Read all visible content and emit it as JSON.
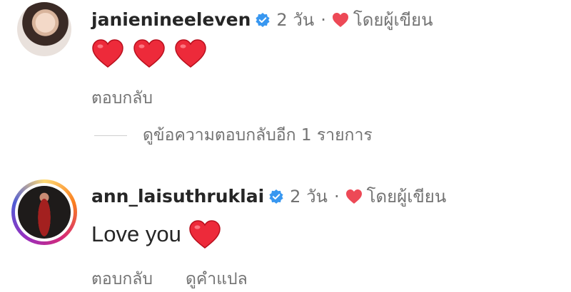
{
  "comments": [
    {
      "username": "janienineeleven",
      "time": "2 วัน",
      "separator": "·",
      "liked_by_author": "โดยผู้เขียน",
      "text": "",
      "reply_label": "ตอบกลับ",
      "view_replies": "ดูข้อความตอบกลับอีก 1 รายการ"
    },
    {
      "username": "ann_laisuthruklai",
      "time": "2 วัน",
      "separator": "·",
      "liked_by_author": "โดยผู้เขียน",
      "text": "Love you",
      "reply_label": "ตอบกลับ",
      "see_translation": "ดูคำแปล"
    }
  ],
  "icons": {
    "verified": "verified-badge-icon",
    "heart": "heart-icon"
  },
  "colors": {
    "heart": "#ed4956",
    "verified": "#3897f0",
    "secondary_text": "#737373"
  }
}
